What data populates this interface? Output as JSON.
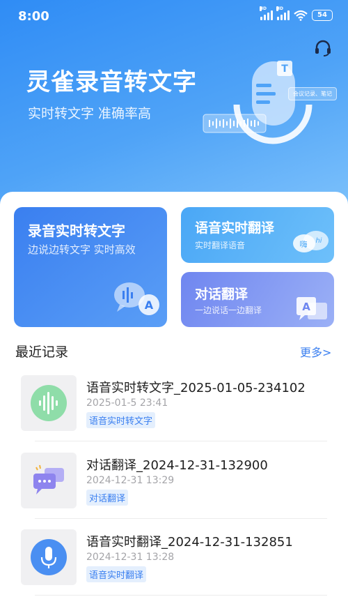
{
  "status_bar": {
    "time": "8:00",
    "battery": "54"
  },
  "hero": {
    "title": "灵雀录音转文字",
    "subtitle": "实时转文字 准确率高",
    "illustration_tag": "会议记录、笔记",
    "illustration_badge": "T",
    "icons": [
      "headset-icon",
      "microphone-illustration",
      "waveform-icon"
    ]
  },
  "features": {
    "record": {
      "title": "录音实时转文字",
      "subtitle": "边说边转文字 实时高效"
    },
    "translate": {
      "title": "语音实时翻译",
      "subtitle": "实时翻译语音",
      "bubble_left": "嗨",
      "bubble_right": "hi"
    },
    "dialog": {
      "title": "对话翻译",
      "subtitle": "一边说话一边翻译",
      "icon_letter": "A"
    }
  },
  "recent": {
    "title": "最近记录",
    "more": "更多>",
    "items": [
      {
        "name": "语音实时转文字_2025-01-05-234102",
        "time": "2025-01-5 23:41",
        "tag": "语音实时转文字",
        "icon": "waveform-icon",
        "color": "#8fdda9"
      },
      {
        "name": "对话翻译_2024-12-31-132900",
        "time": "2024-12-31 13:29",
        "tag": "对话翻译",
        "icon": "chat-bubbles-icon",
        "color": "#8e84ee"
      },
      {
        "name": "语音实时翻译_2024-12-31-132851",
        "time": "2024-12-31 13:28",
        "tag": "语音实时翻译",
        "icon": "microphone-icon",
        "color": "#4a8ff2"
      }
    ]
  },
  "colors": {
    "accent": "#3a7ff0",
    "hero_start": "#2f8cf5",
    "hero_end": "#7cc1fb"
  }
}
